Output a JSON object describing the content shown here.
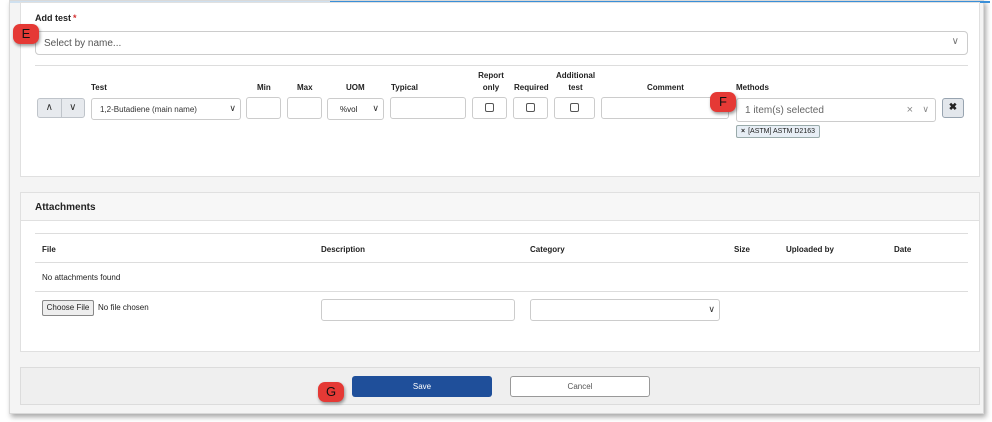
{
  "add_test": {
    "label": "Add test",
    "required_mark": "*",
    "placeholder": "Select by name...",
    "chevron": "chevron-down-icon"
  },
  "table": {
    "headers": {
      "test": "Test",
      "min": "Min",
      "max": "Max",
      "uom": "UOM",
      "typical": "Typical",
      "report_only_1": "Report",
      "report_only_2": "only",
      "required": "Required",
      "additional_1": "Additional",
      "additional_2": "test",
      "comment": "Comment",
      "methods": "Methods"
    },
    "row": {
      "move_up": "▲",
      "move_down": "▼",
      "test_value": "1,2-Butadiene (main name)",
      "min": "",
      "max": "",
      "uom_value": "%vol",
      "typical": "",
      "comment": "",
      "methods_summary": "1 item(s) selected",
      "method_chip": "[ASTM] ASTM D2163",
      "chip_remove": "×",
      "remove": "✖"
    }
  },
  "markers": {
    "e": "E",
    "f": "F",
    "g": "G"
  },
  "attachments": {
    "title": "Attachments",
    "headers": {
      "file": "File",
      "description": "Description",
      "category": "Category",
      "size": "Size",
      "uploaded_by": "Uploaded by",
      "date": "Date"
    },
    "empty_message": "No attachments found",
    "choose_file": "Choose File",
    "no_file": "No file chosen"
  },
  "footer": {
    "save": "Save",
    "cancel": "Cancel"
  },
  "colors": {
    "save_bg": "#1f4f9a",
    "marker_bg": "#e53935",
    "accent_line": "#3a8fd8"
  }
}
